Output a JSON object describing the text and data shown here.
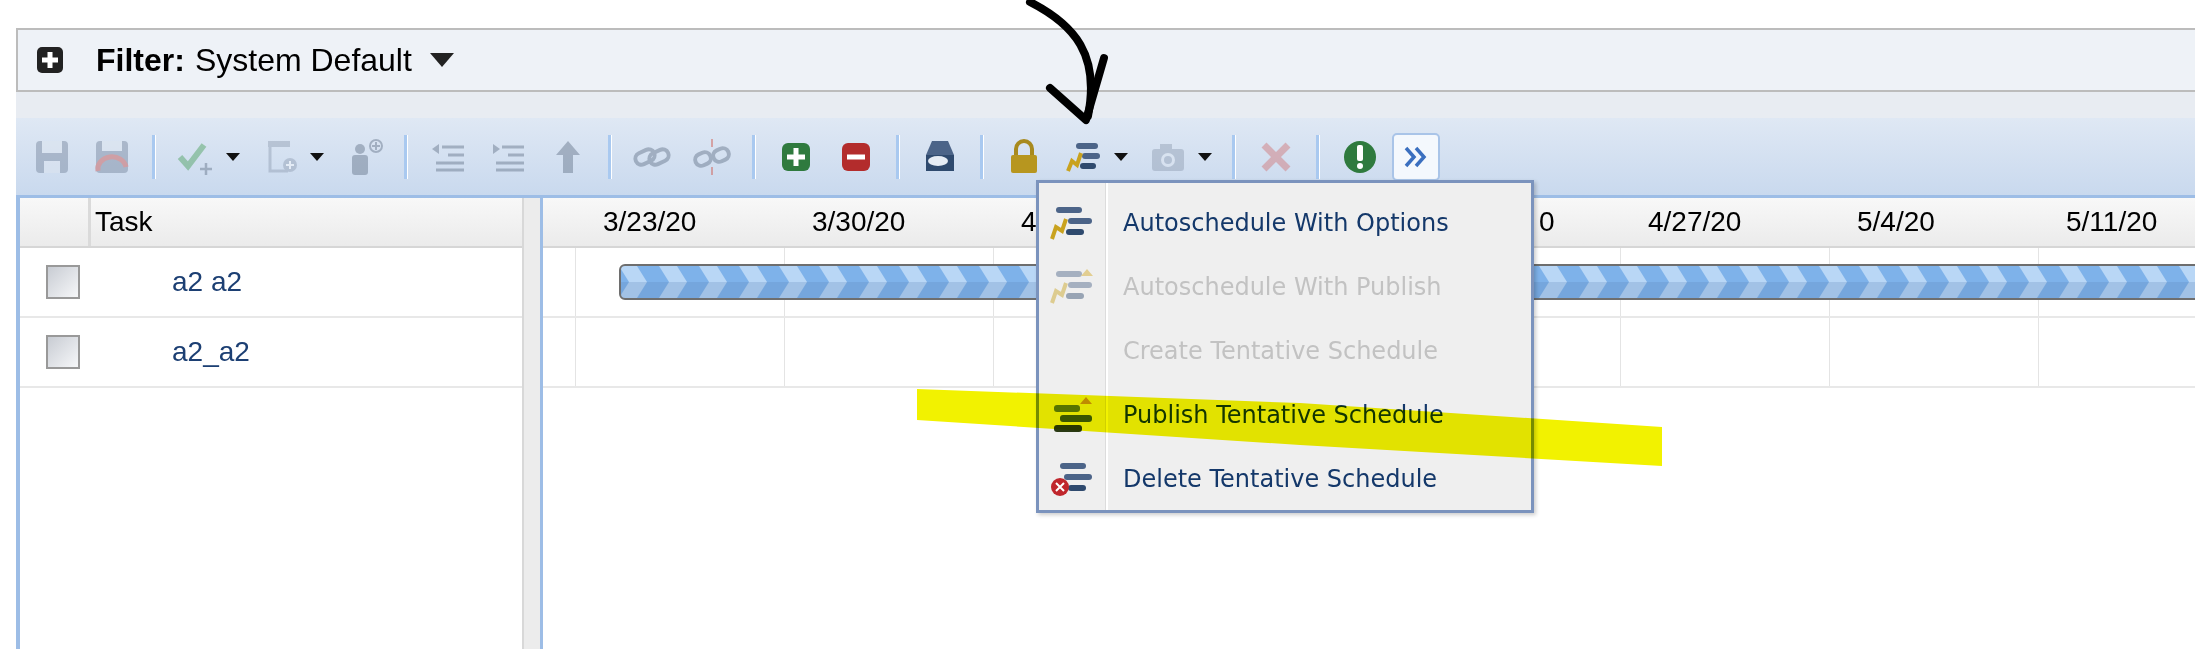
{
  "filter": {
    "label": "Filter:",
    "value": "System Default"
  },
  "toolbar": [
    {
      "kind": "save",
      "disabled": true
    },
    {
      "kind": "revert",
      "disabled": true
    },
    {
      "kind": "separator"
    },
    {
      "kind": "check-add",
      "disabled": true,
      "has_menu": true
    },
    {
      "kind": "network",
      "disabled": true,
      "has_menu": true
    },
    {
      "kind": "user-add",
      "disabled": true
    },
    {
      "kind": "separator"
    },
    {
      "kind": "outdent",
      "disabled": true
    },
    {
      "kind": "indent",
      "disabled": true
    },
    {
      "kind": "move-up",
      "disabled": true
    },
    {
      "kind": "separator"
    },
    {
      "kind": "link",
      "disabled": true
    },
    {
      "kind": "unlink",
      "disabled": true
    },
    {
      "kind": "separator"
    },
    {
      "kind": "add",
      "disabled": false
    },
    {
      "kind": "remove",
      "disabled": false
    },
    {
      "kind": "separator"
    },
    {
      "kind": "print",
      "disabled": false
    },
    {
      "kind": "separator"
    },
    {
      "kind": "lock",
      "disabled": false
    },
    {
      "kind": "autoschedule",
      "disabled": false,
      "has_menu": true
    },
    {
      "kind": "camera",
      "disabled": true,
      "has_menu": true
    },
    {
      "kind": "separator"
    },
    {
      "kind": "delete",
      "disabled": true
    },
    {
      "kind": "separator"
    },
    {
      "kind": "alert",
      "disabled": false
    },
    {
      "kind": "expand",
      "disabled": false
    }
  ],
  "task_table": {
    "columns": [
      "Task"
    ],
    "rows": [
      {
        "name": "a2 a2",
        "checked": false,
        "bar": true
      },
      {
        "name": "a2_a2",
        "checked": false,
        "bar": false
      }
    ]
  },
  "timeline": {
    "columns": [
      {
        "label": "3/23/20"
      },
      {
        "label": "3/30/20"
      },
      {
        "label": "4"
      },
      {},
      {
        "label": "0",
        "cut_left": true
      },
      {
        "label": "4/27/20"
      },
      {
        "label": "5/4/20"
      },
      {
        "label": "5/11/20"
      }
    ]
  },
  "menu": {
    "items": [
      {
        "kind": "autoschedule",
        "label": "Autoschedule With Options",
        "disabled": false
      },
      {
        "kind": "autoschedule-publish",
        "label": "Autoschedule With Publish",
        "disabled": true
      },
      {
        "kind": "create",
        "label": "Create Tentative Schedule",
        "disabled": true
      },
      {
        "kind": "publish",
        "label": "Publish Tentative Schedule",
        "disabled": false
      },
      {
        "kind": "delete",
        "label": "Delete Tentative Schedule",
        "disabled": false
      }
    ]
  }
}
